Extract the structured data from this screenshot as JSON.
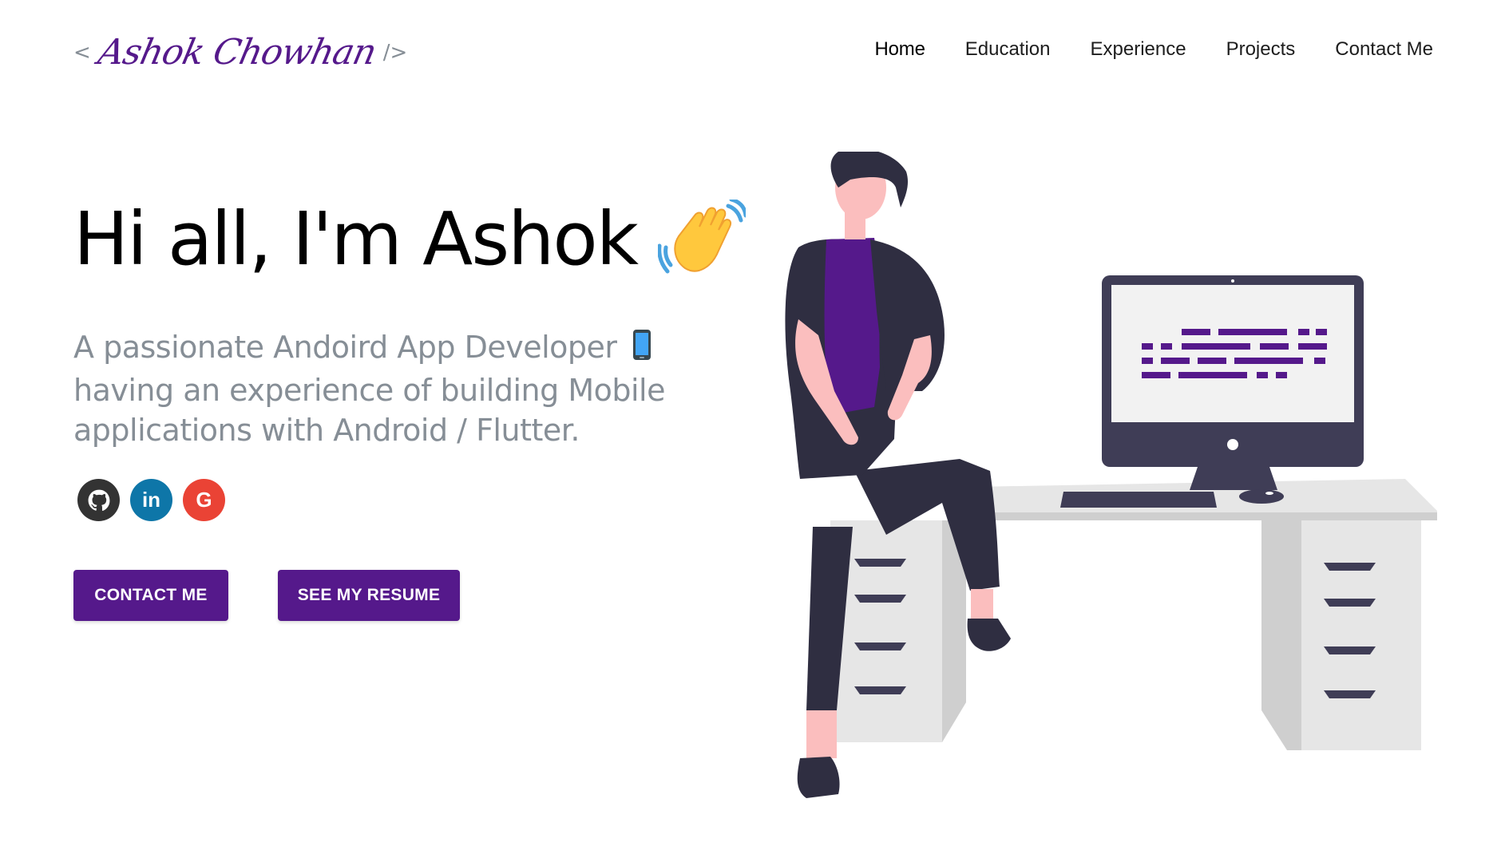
{
  "header": {
    "logo_open": "<",
    "logo_name": "Ashok Chowhan",
    "logo_close": "/>",
    "nav": [
      {
        "label": "Home"
      },
      {
        "label": "Education"
      },
      {
        "label": "Experience"
      },
      {
        "label": "Projects"
      },
      {
        "label": "Contact Me"
      }
    ]
  },
  "hero": {
    "greeting": "Hi all, I'm Ashok",
    "wave_icon": "waving-hand-icon",
    "subtitle": "A passionate Andoird App Developer",
    "subtitle_rest": "having an experience of building Mobile applications with Android / Flutter.",
    "phone_icon": "mobile-phone-icon",
    "socials": [
      {
        "name": "github-icon"
      },
      {
        "name": "linkedin-icon",
        "text": "in"
      },
      {
        "name": "google-icon",
        "text": "G"
      }
    ],
    "buttons": {
      "contact": "CONTACT ME",
      "resume": "SEE MY RESUME"
    }
  },
  "colors": {
    "accent": "#55198b",
    "text_primary": "#000000",
    "text_secondary": "#868e96",
    "github": "#333333",
    "linkedin": "#0e76a8",
    "google": "#ea4335"
  }
}
